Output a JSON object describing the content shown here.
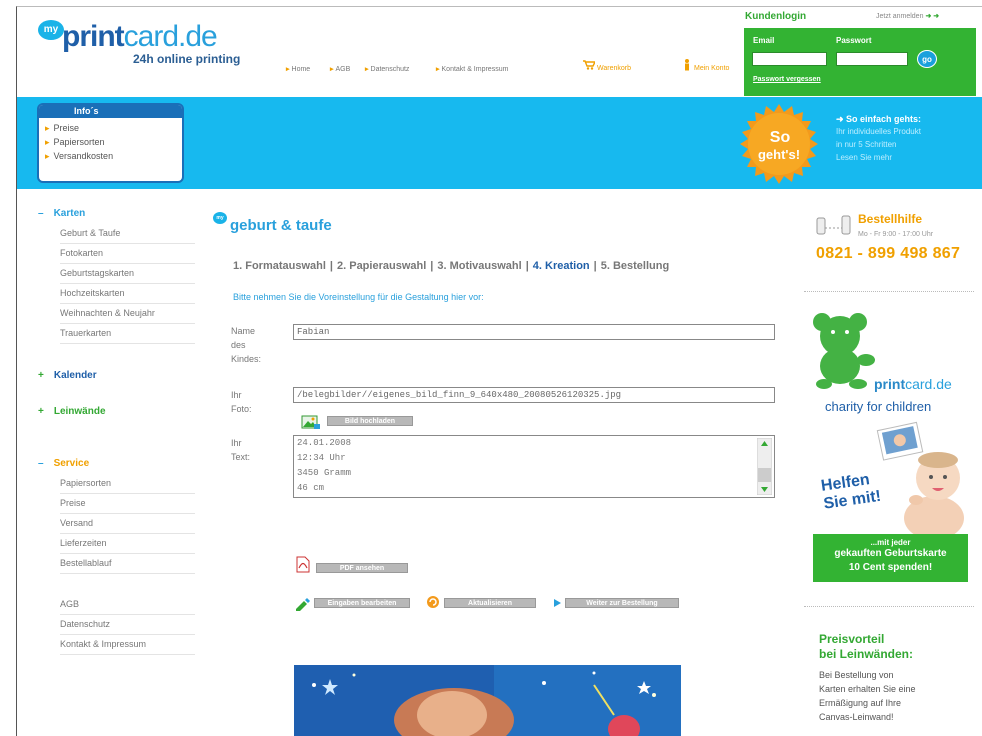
{
  "header": {
    "logo_badge": "my",
    "logo_print": "print",
    "logo_card": "card.de",
    "tagline": "24h online printing",
    "nav": [
      "Home",
      "AGB",
      "Datenschutz",
      "Kontakt & Impressum"
    ],
    "cart": "Warenkorb",
    "account": "Mein Konto"
  },
  "login": {
    "title": "Kundenlogin",
    "register": "Jetzt anmelden",
    "register_arrows": "➜ ➜",
    "email_label": "Email",
    "password_label": "Passwort",
    "go": "go",
    "forgot": "Passwort vergessen"
  },
  "banner": {
    "info_title": "Info´s",
    "info_items": [
      "Preise",
      "Papiersorten",
      "Versandkosten"
    ],
    "badge_line1": "So",
    "badge_line2": "geht's!",
    "so_title": "➜ So einfach gehts:",
    "so_lines": [
      "Ihr individuelles Produkt",
      "in nur 5 Schritten",
      "Lesen Sie mehr"
    ]
  },
  "sidebar": {
    "karten": {
      "title": "Karten",
      "items": [
        "Geburt & Taufe",
        "Fotokarten",
        "Geburtstagskarten",
        "Hochzeitskarten",
        "Weihnachten & Neujahr",
        "Trauerkarten"
      ]
    },
    "kalender": "Kalender",
    "leinwaende": "Leinwände",
    "service": {
      "title": "Service",
      "items": [
        "Papiersorten",
        "Preise",
        "Versand",
        "Lieferzeiten",
        "Bestellablauf"
      ]
    },
    "footer_items": [
      "AGB",
      "Datenschutz",
      "Kontakt & Impressum"
    ]
  },
  "main": {
    "badge": "my",
    "title": "geburt & taufe",
    "steps": [
      "1. Formatauswahl",
      "2. Papierauswahl",
      "3. Motivauswahl",
      "4. Kreation",
      "5. Bestellung"
    ],
    "steps_sep": "|",
    "active_step": 3,
    "instruction": "Bitte nehmen Sie die Voreinstellung für die Gestaltung hier vor:",
    "name_label": [
      "Name",
      "des",
      "Kindes:"
    ],
    "name_value": "Fabian",
    "photo_label": [
      "Ihr",
      "Foto:"
    ],
    "photo_value": "/belegbilder//eigenes_bild_finn_9_640x480_20080526120325.jpg",
    "photo_button": "Bild hochladen",
    "text_label": [
      "Ihr",
      "Text:"
    ],
    "text_lines": [
      "24.01.2008",
      "12:34 Uhr",
      "3450 Gramm",
      "46 cm"
    ],
    "pdf_button": "PDF ansehen",
    "btn_edit": "Eingaben bearbeiten",
    "btn_update": "Aktualisieren",
    "btn_next": "Weiter zur Bestellung"
  },
  "right": {
    "hotline_title": "Bestellhilfe",
    "hotline_hours": "Mo - Fr 9:00 - 17:00 Uhr",
    "hotline_phone": "0821 - 899 498 867",
    "charity_brand_print": "print",
    "charity_brand_card": "card.de",
    "charity_text": "charity for children",
    "helfen_1": "Helfen",
    "helfen_2": "Sie mit!",
    "green_1": "...mit jeder",
    "green_2": "gekauften Geburtskarte",
    "green_3": "10 Cent spenden!",
    "pv_title_1": "Preisvorteil",
    "pv_title_2": "bei Leinwänden:",
    "pv_lines": [
      "Bei Bestellung von",
      "Karten erhalten Sie eine",
      "Ermäßigung auf Ihre",
      "Canvas-Leinwand!"
    ]
  },
  "colors": {
    "brand_blue": "#29a0dc",
    "banner_blue": "#17b9ef",
    "green": "#33b333",
    "orange": "#f0a000",
    "dark_blue": "#1f5fa8"
  }
}
